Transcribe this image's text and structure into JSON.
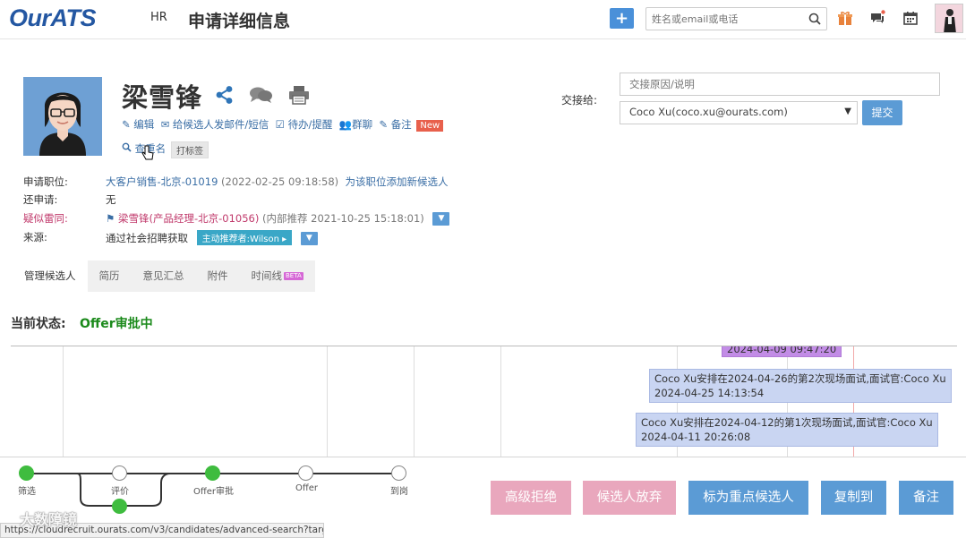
{
  "header": {
    "logo_our": "Our",
    "logo_ats": "ATS",
    "hr": "HR",
    "title": "申请详细信息",
    "add": "+",
    "search_placeholder": "姓名或email或电话"
  },
  "candidate": {
    "name": "梁雪锋",
    "actions": {
      "edit": "编辑",
      "email": "给候选人发邮件/短信",
      "todo": "待办/提醒",
      "related": "群聊",
      "note": "备注",
      "new_badge": "New",
      "duplicate": "查重名",
      "tag": "打标签"
    }
  },
  "transfer": {
    "label": "交接给:",
    "reason_placeholder": "交接原因/说明",
    "selected": "Coco Xu(coco.xu@ourats.com)",
    "submit": "提交"
  },
  "info": {
    "position_label": "申请职位:",
    "position_value": "大客户销售-北京-01019",
    "position_time": "(2022-02-25 09:18:58)",
    "position_link": "为该职位添加新候选人",
    "other_label": "还申请:",
    "other_value": "无",
    "similar_label": "疑似雷同:",
    "similar_value": "梁雪锋(产品经理-北京-01056)",
    "similar_note": "(内部推荐 2021-10-25 15:18:01)",
    "source_label": "来源:",
    "source_value": "通过社会招聘获取",
    "source_badge": "主动推荐者:Wilson"
  },
  "tabs": [
    "管理候选人",
    "简历",
    "意见汇总",
    "附件",
    "时间线"
  ],
  "tab_beta": "BETA",
  "status": {
    "label": "当前状态:",
    "value": "Offer审批中"
  },
  "timeline_events": [
    {
      "text": "2024-04-09 09:47:20"
    },
    {
      "line1": "Coco Xu安排在2024-04-26的第2次现场面试,面试官:Coco Xu",
      "line2": "2024-04-25 14:13:54"
    },
    {
      "line1": "Coco Xu安排在2024-04-12的第1次现场面试,面试官:Coco Xu",
      "line2": "2024-04-11 20:26:08"
    }
  ],
  "stages": [
    "筛选",
    "评价",
    "Offer审批",
    "Offer",
    "到岗"
  ],
  "buttons": {
    "reject": "高级拒绝",
    "give_up": "候选人放弃",
    "mark_key": "标为重点候选人",
    "copy_to": "复制到",
    "note": "备注"
  },
  "colors": {
    "primary": "#5b9bd5",
    "reject": "#e9a7bd",
    "done_stage": "#3fbc3f",
    "status_green": "#1b8a1b"
  },
  "statusbar_url": "https://cloudrecruit.ourats.com/v3/candidates/advanced-search?target...",
  "watermark": "大数障镜"
}
